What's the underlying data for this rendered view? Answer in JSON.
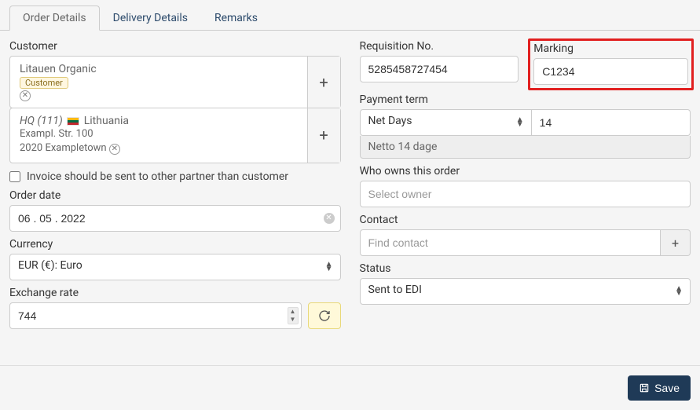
{
  "tabs": {
    "order_details": "Order Details",
    "delivery_details": "Delivery Details",
    "remarks": "Remarks"
  },
  "left": {
    "customer_label": "Customer",
    "customer1_name": "Litauen Organic",
    "customer1_badge": "Customer",
    "customer2_hq_prefix": "HQ (111)",
    "customer2_country": "Lithuania",
    "customer2_addr1": "Exampl. Str. 100",
    "customer2_addr2": "2020 Exampletown",
    "invoice_other_label": "Invoice should be sent to other partner than customer",
    "order_date_label": "Order date",
    "order_date_value": "06 . 05 . 2022",
    "currency_label": "Currency",
    "currency_value": "EUR (€): Euro",
    "exchange_rate_label": "Exchange rate",
    "exchange_rate_value": "744"
  },
  "right": {
    "requisition_label": "Requisition No.",
    "requisition_value": "5285458727454",
    "marking_label": "Marking",
    "marking_value": "C1234",
    "payment_term_label": "Payment term",
    "payment_term_select": "Net Days",
    "payment_term_days": "14",
    "payment_term_sub": "Netto 14 dage",
    "owner_label": "Who owns this order",
    "owner_placeholder": "Select owner",
    "contact_label": "Contact",
    "contact_placeholder": "Find contact",
    "status_label": "Status",
    "status_value": "Sent to EDI"
  },
  "footer": {
    "save_label": "Save"
  }
}
